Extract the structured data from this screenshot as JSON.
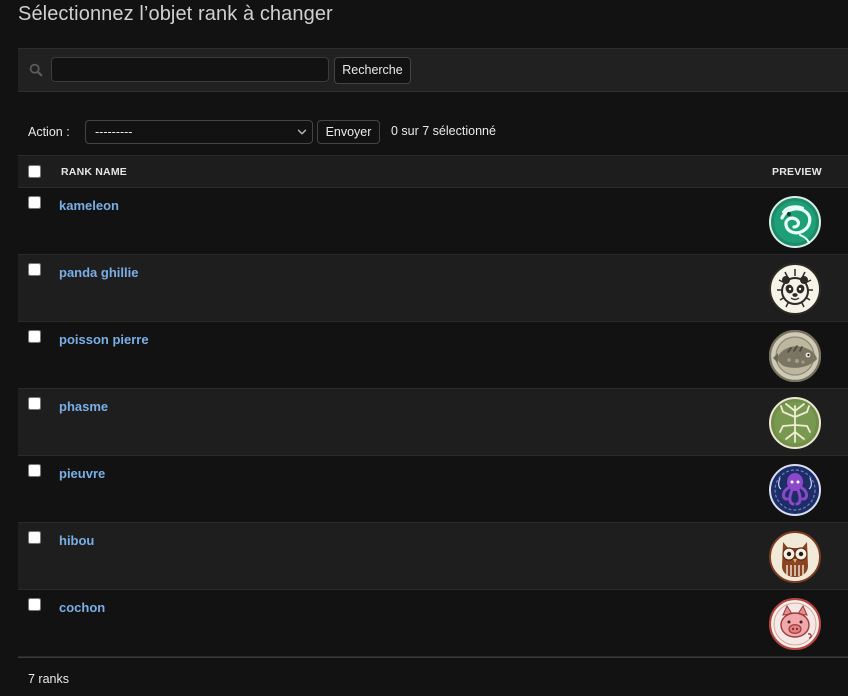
{
  "page": {
    "title": "Sélectionnez l’objet rank à changer"
  },
  "search": {
    "value": "",
    "placeholder": "",
    "button_label": "Recherche"
  },
  "actions": {
    "label": "Action :",
    "selected": "---------",
    "go_label": "Envoyer",
    "counter": "0 sur 7 sélectionné"
  },
  "table": {
    "columns": [
      "RANK NAME",
      "PREVIEW"
    ],
    "rows": [
      {
        "name": "kameleon",
        "preview_icon": "chameleon-badge-icon"
      },
      {
        "name": "panda ghillie",
        "preview_icon": "panda-badge-icon"
      },
      {
        "name": "poisson pierre",
        "preview_icon": "stonefish-badge-icon"
      },
      {
        "name": "phasme",
        "preview_icon": "stick-insect-badge-icon"
      },
      {
        "name": "pieuvre",
        "preview_icon": "octopus-badge-icon"
      },
      {
        "name": "hibou",
        "preview_icon": "owl-badge-icon"
      },
      {
        "name": "cochon",
        "preview_icon": "pig-badge-icon"
      }
    ]
  },
  "footer": {
    "count": "7 ranks"
  },
  "colors": {
    "page_background": "#121212",
    "row_link": "#79aee6",
    "toolbar_background": "#212121",
    "text": "#eaeaea"
  }
}
